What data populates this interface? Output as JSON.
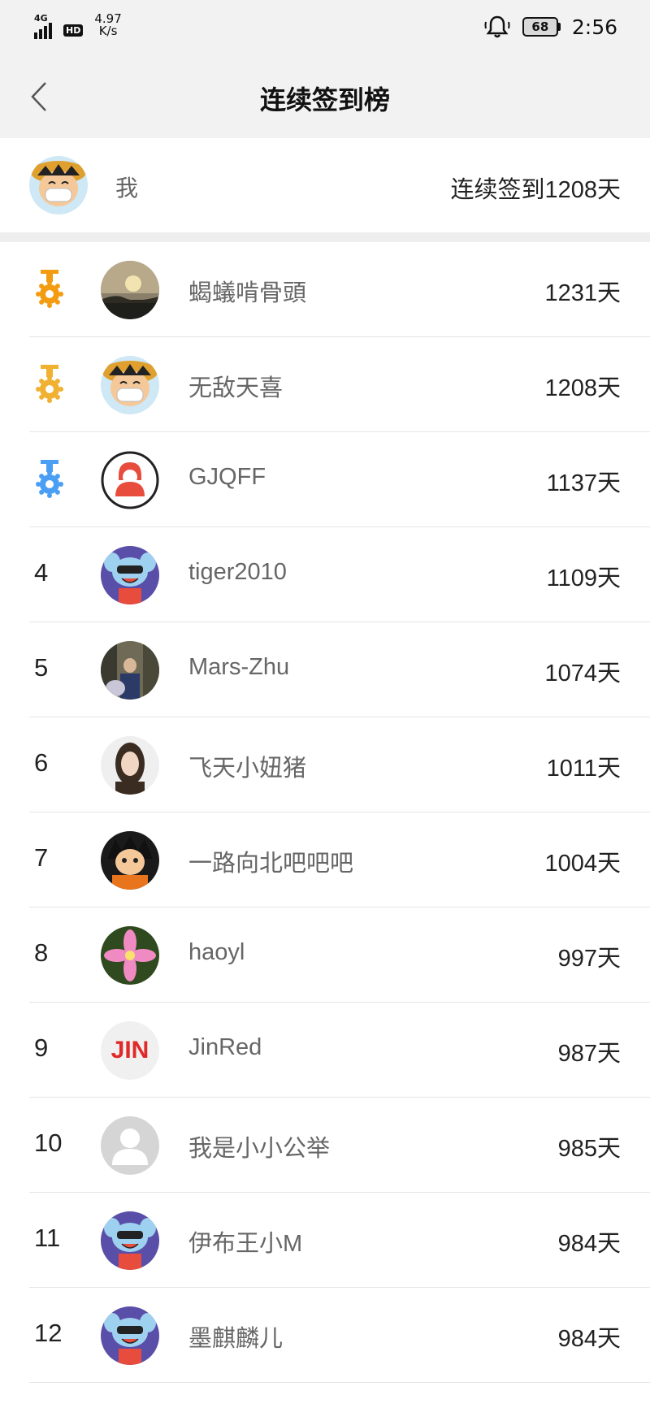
{
  "status_bar": {
    "network": "4G",
    "hd": "HD",
    "speed_value": "4.97",
    "speed_unit": "K/s",
    "battery": "68",
    "time": "2:56"
  },
  "nav": {
    "title": "连续签到榜"
  },
  "me": {
    "name": "我",
    "streak": "连续签到1208天"
  },
  "medal_colors": {
    "gold": "#f39c12",
    "silver": "#f0b030",
    "bronze": "#4a9ff5"
  },
  "leaderboard": [
    {
      "rank": "",
      "medal": "gold",
      "name": "蝎蟻啃骨頭",
      "days": "1231天",
      "avatar": "photo-sky"
    },
    {
      "rank": "",
      "medal": "silver",
      "name": "无敌天喜",
      "days": "1208天",
      "avatar": "cartoon-luffy"
    },
    {
      "rank": "",
      "medal": "bronze",
      "name": "GJQFF",
      "days": "1137天",
      "avatar": "red-hood"
    },
    {
      "rank": "4",
      "medal": "",
      "name": "tiger2010",
      "days": "1109天",
      "avatar": "cartoon-mascot"
    },
    {
      "rank": "5",
      "medal": "",
      "name": "Mars-Zhu",
      "days": "1074天",
      "avatar": "photo-people"
    },
    {
      "rank": "6",
      "medal": "",
      "name": "飞天小妞猪",
      "days": "1011天",
      "avatar": "photo-girl"
    },
    {
      "rank": "7",
      "medal": "",
      "name": "一路向北吧吧吧",
      "days": "1004天",
      "avatar": "cartoon-goku"
    },
    {
      "rank": "8",
      "medal": "",
      "name": "haoyl",
      "days": "997天",
      "avatar": "photo-flower"
    },
    {
      "rank": "9",
      "medal": "",
      "name": "JinRed",
      "days": "987天",
      "avatar": "jin-logo"
    },
    {
      "rank": "10",
      "medal": "",
      "name": "我是小小公举",
      "days": "985天",
      "avatar": "default-person"
    },
    {
      "rank": "11",
      "medal": "",
      "name": "伊布王小M",
      "days": "984天",
      "avatar": "cartoon-mascot"
    },
    {
      "rank": "12",
      "medal": "",
      "name": "墨麒麟儿",
      "days": "984天",
      "avatar": "cartoon-mascot"
    }
  ],
  "jin_logo_text": "JIN"
}
